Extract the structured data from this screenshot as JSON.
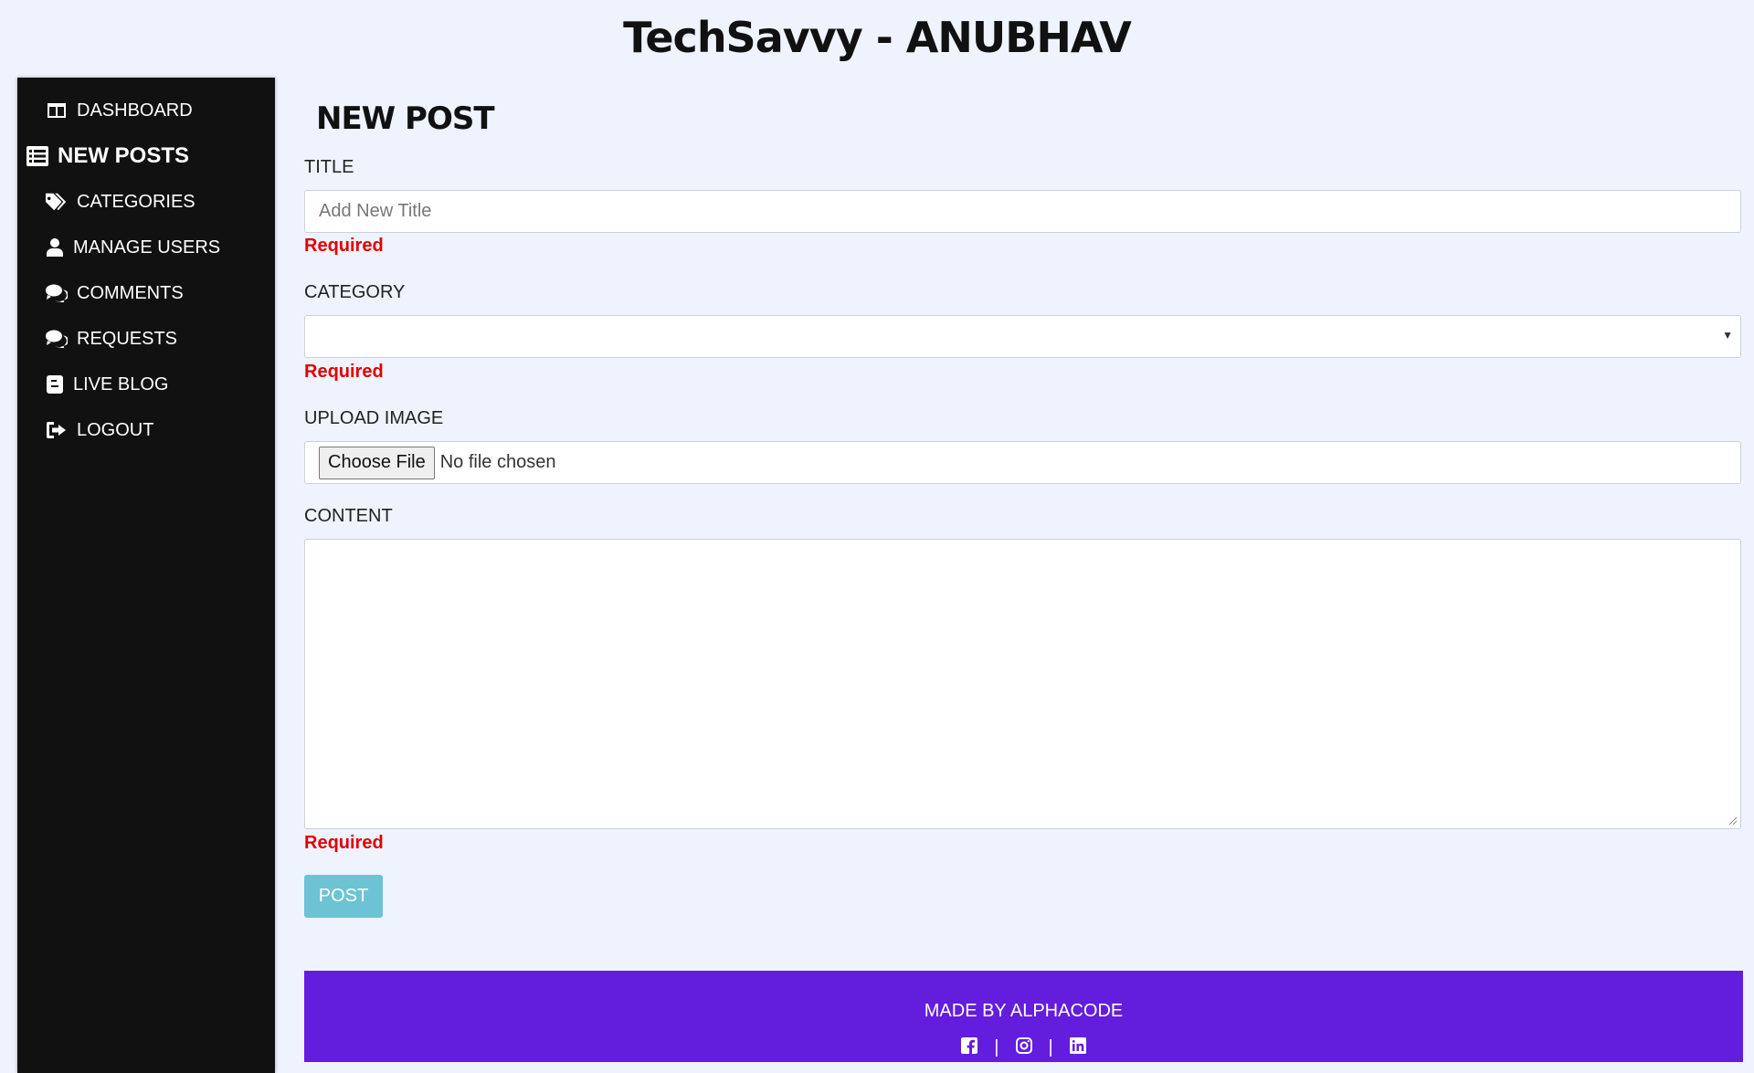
{
  "app": {
    "title": "TechSavvy - ANUBHAV"
  },
  "sidebar": {
    "items": [
      {
        "label": "DASHBOARD",
        "icon": "columns-icon"
      },
      {
        "label": "NEW POSTS",
        "icon": "list-icon",
        "active": true
      },
      {
        "label": "CATEGORIES",
        "icon": "tags-icon"
      },
      {
        "label": "MANAGE USERS",
        "icon": "user-icon"
      },
      {
        "label": "COMMENTS",
        "icon": "comments-icon"
      },
      {
        "label": "REQUESTS",
        "icon": "comments-icon"
      },
      {
        "label": "LIVE BLOG",
        "icon": "blogger-icon"
      },
      {
        "label": "LOGOUT",
        "icon": "sign-out-icon"
      }
    ]
  },
  "form": {
    "heading": "NEW POST",
    "title_label": "TITLE",
    "title_placeholder": "Add New Title",
    "title_value": "",
    "category_label": "CATEGORY",
    "category_value": "",
    "upload_label": "UPLOAD IMAGE",
    "choose_file_label": "Choose File",
    "file_status": "No file chosen",
    "content_label": "CONTENT",
    "content_value": "",
    "required_text": "Required",
    "post_label": "POST"
  },
  "footer": {
    "text": "MADE BY ALPHACODE",
    "separator": "|",
    "social": [
      "facebook-icon",
      "instagram-icon",
      "linkedin-icon"
    ]
  },
  "colors": {
    "background": "#eef3fd",
    "sidebar": "#111111",
    "footer": "#631ddd",
    "required": "#e00000",
    "post_button": "#6cc3d4"
  }
}
